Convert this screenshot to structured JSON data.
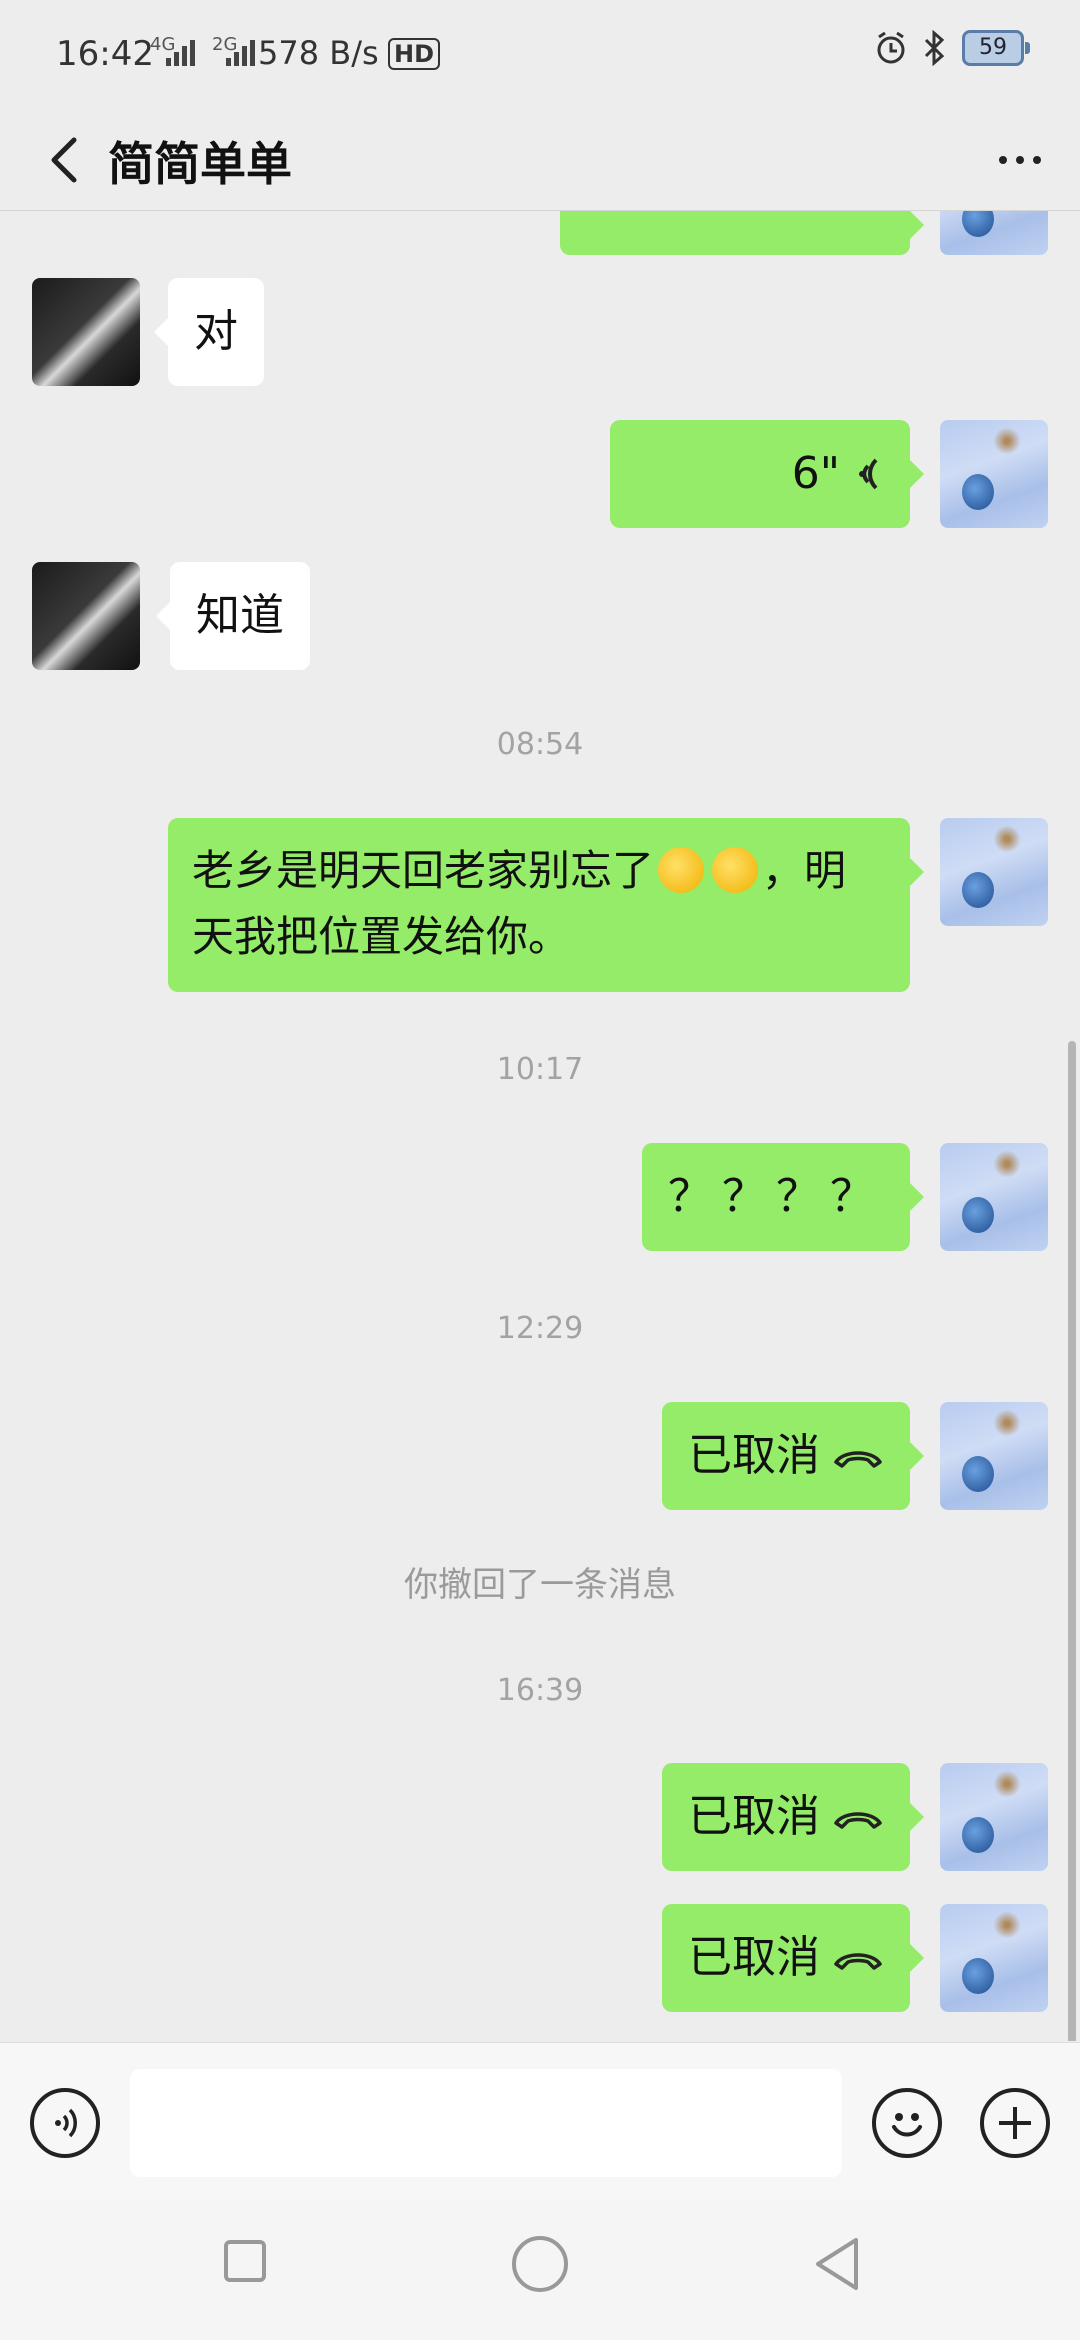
{
  "status_bar": {
    "time": "16:42",
    "network_4g": "4G",
    "network_2g": "2G",
    "speed": "578 B/s",
    "hd": "HD",
    "battery": "59"
  },
  "header": {
    "title": "简简单单"
  },
  "messages": [
    {
      "side": "left",
      "text": "对"
    },
    {
      "side": "right",
      "text": "6\""
    },
    {
      "side": "left",
      "text": "知道"
    },
    {
      "type": "time",
      "text": "08:54"
    },
    {
      "side": "right",
      "text_before": "老乡是明天回老家别忘了",
      "text_after": "，明天我把位置发给你。"
    },
    {
      "type": "time",
      "text": "10:17"
    },
    {
      "side": "right",
      "text": "？？？？"
    },
    {
      "type": "time",
      "text": "12:29"
    },
    {
      "side": "right",
      "text": "已取消"
    },
    {
      "type": "system",
      "text": "你撤回了一条消息"
    },
    {
      "type": "time",
      "text": "16:39"
    },
    {
      "side": "right",
      "text": "已取消"
    },
    {
      "side": "right",
      "text": "已取消"
    }
  ],
  "input": {
    "value": "",
    "placeholder": ""
  },
  "colors": {
    "bubble_right": "#95ec69",
    "bubble_left": "#ffffff",
    "background": "#ededed"
  }
}
